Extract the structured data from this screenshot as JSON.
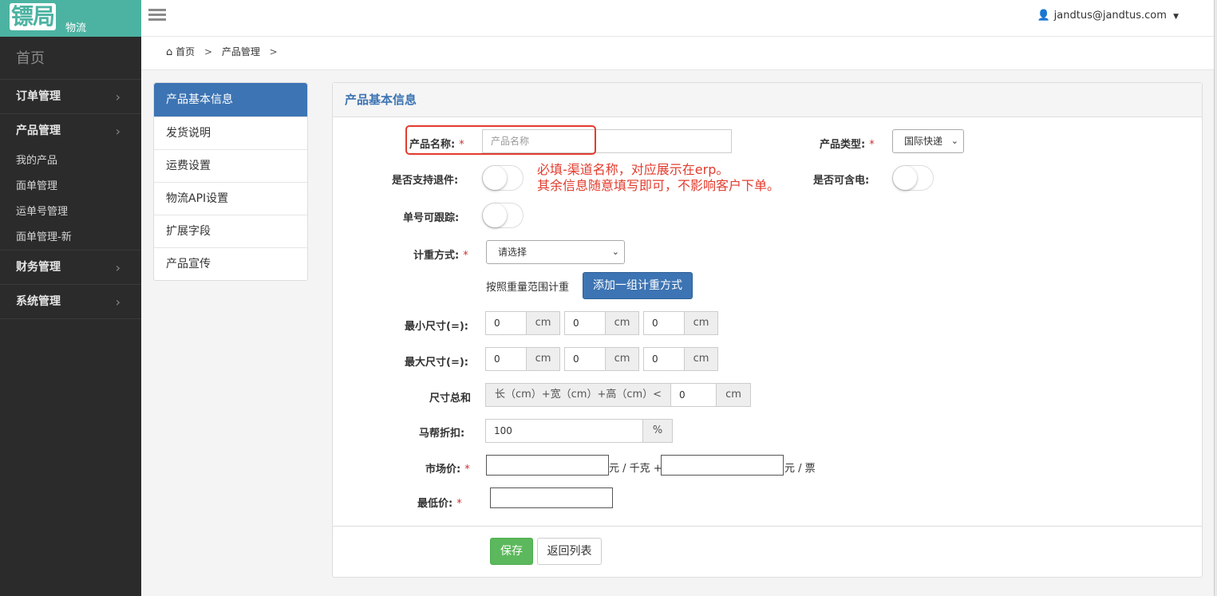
{
  "app": {
    "logo_text": "镖局",
    "logo_sub": "物流",
    "user_email": "jandtus@jandtus.com"
  },
  "sidebar": {
    "home": "首页",
    "groups": [
      {
        "label": "订单管理"
      },
      {
        "label": "产品管理"
      },
      {
        "label": "财务管理"
      },
      {
        "label": "系统管理"
      }
    ],
    "product_sub": [
      "我的产品",
      "面单管理",
      "运单号管理",
      "面单管理-新"
    ]
  },
  "breadcrumb": {
    "home": "首页",
    "current": "产品管理",
    "sep": ">"
  },
  "tabs": [
    "产品基本信息",
    "发货说明",
    "运费设置",
    "物流API设置",
    "扩展字段",
    "产品宣传"
  ],
  "panel": {
    "title": "产品基本信息"
  },
  "form": {
    "name_label": "产品名称:",
    "name_placeholder": "产品名称",
    "type_label": "产品类型:",
    "type_value": "国际快递",
    "return_label": "是否支持退件:",
    "battery_label": "是否可含电:",
    "track_label": "单号可跟踪:",
    "weight_label": "计重方式:",
    "weight_value": "请选择",
    "weight_range_text": "按照重量范围计重",
    "add_weight_button": "添加一组计重方式",
    "min_size_label": "最小尺寸(=):",
    "max_size_label": "最大尺寸(=):",
    "min_size": [
      "0",
      "0",
      "0"
    ],
    "max_size": [
      "0",
      "0",
      "0"
    ],
    "unit_cm": "cm",
    "size_sum_label": "尺寸总和",
    "size_sum_formula": "长（cm）+宽（cm）+高（cm）<",
    "size_sum_value": "0",
    "discount_label": "马帮折扣:",
    "discount_value": "100",
    "percent": "%",
    "market_price_label": "市场价:",
    "per_kg": "元 / 千克 +",
    "per_ticket": "元 / 票",
    "min_price_label": "最低价:",
    "required_mark": "*",
    "save_button": "保存",
    "back_button": "返回列表"
  },
  "annotation": {
    "line1": "必填-渠道名称，对应展示在erp。",
    "line2": "其余信息随意填写即可，不影响客户下单。"
  },
  "colors": {
    "accent": "#3d74b3",
    "logo_bg": "#4cb3a2",
    "sidebar_bg": "#2b2b2b",
    "annotation": "#e23c2e",
    "save": "#5cb85c"
  }
}
